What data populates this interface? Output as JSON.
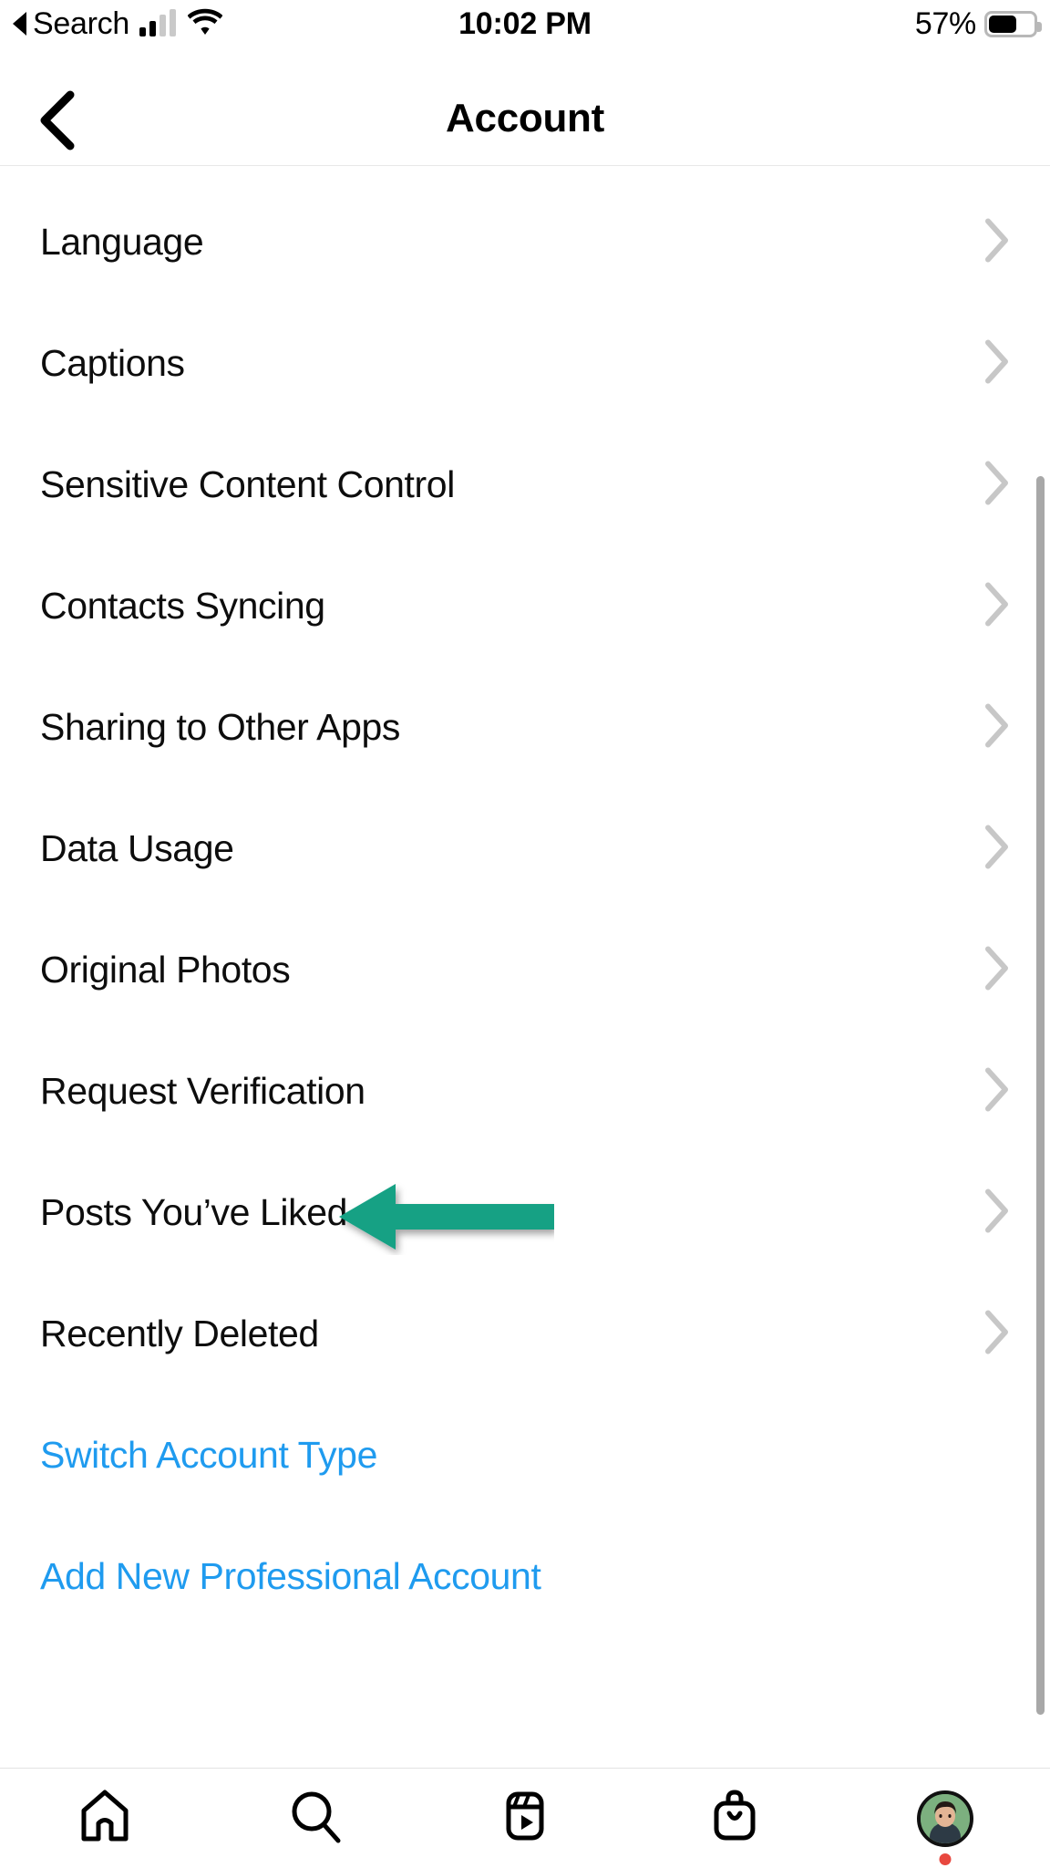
{
  "status_bar": {
    "back_label": "Search",
    "back_icon": "triangle-left-icon",
    "signal_icon": "cellular-signal-icon",
    "signal_bars_filled": 2,
    "signal_bars_total": 4,
    "wifi_icon": "wifi-icon",
    "time": "10:02 PM",
    "battery_percent_label": "57%",
    "battery_level": 57,
    "battery_icon": "battery-icon"
  },
  "navbar": {
    "back_icon": "chevron-left-icon",
    "title": "Account"
  },
  "settings_list": {
    "chevron_icon": "chevron-right-icon",
    "items": [
      {
        "label": "Language",
        "type": "nav"
      },
      {
        "label": "Captions",
        "type": "nav"
      },
      {
        "label": "Sensitive Content Control",
        "type": "nav"
      },
      {
        "label": "Contacts Syncing",
        "type": "nav"
      },
      {
        "label": "Sharing to Other Apps",
        "type": "nav"
      },
      {
        "label": "Data Usage",
        "type": "nav"
      },
      {
        "label": "Original Photos",
        "type": "nav"
      },
      {
        "label": "Request Verification",
        "type": "nav"
      },
      {
        "label": "Posts You’ve Liked",
        "type": "nav"
      },
      {
        "label": "Recently Deleted",
        "type": "nav"
      },
      {
        "label": "Switch Account Type",
        "type": "link"
      },
      {
        "label": "Add New Professional Account",
        "type": "link"
      }
    ]
  },
  "annotation": {
    "name": "green-arrow-pointing-to-posts-youve-liked",
    "shape": "left-arrow",
    "color": "#12a184",
    "target_label": "Posts You’ve Liked"
  },
  "scrollbar": {
    "name": "vertical-scrollbar",
    "color": "#a8a8a8"
  },
  "tab_bar": {
    "tabs": [
      {
        "name": "home-icon",
        "label": "Home"
      },
      {
        "name": "search-icon",
        "label": "Search"
      },
      {
        "name": "reels-icon",
        "label": "Reels"
      },
      {
        "name": "shop-icon",
        "label": "Shop"
      },
      {
        "name": "profile-avatar",
        "label": "Profile"
      }
    ],
    "profile_badge": true,
    "profile_badge_color": "#e8483f"
  },
  "colors": {
    "link_blue": "#1f9bef",
    "text_black": "#0d0d0d",
    "chevron_gray": "#c7c7c7",
    "divider": "#e8e8e8",
    "annotation_green": "#12a184"
  }
}
